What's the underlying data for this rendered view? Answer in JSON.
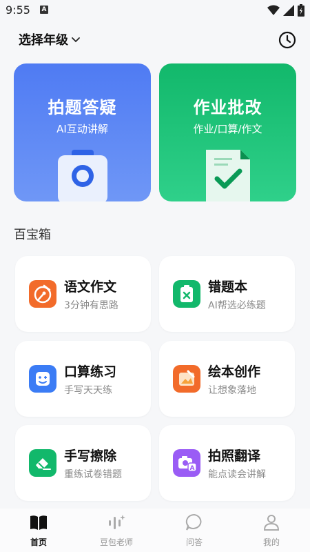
{
  "status_bar": {
    "time": "9:55",
    "notification_letter": "A"
  },
  "header": {
    "grade_selector": "选择年级"
  },
  "feature_cards": [
    {
      "title": "拍题答疑",
      "subtitle": "AI互动讲解",
      "color": "#4f7bf3"
    },
    {
      "title": "作业批改",
      "subtitle": "作业/口算/作文",
      "color": "#12b86b"
    }
  ],
  "toolbox": {
    "title": "百宝箱",
    "items": [
      {
        "name": "语文作文",
        "desc": "3分钟有思路",
        "color": "#f26b2a",
        "icon": "pen-icon"
      },
      {
        "name": "错题本",
        "desc": "AI帮选必练题",
        "color": "#12b86b",
        "icon": "clipboard-x-icon"
      },
      {
        "name": "口算练习",
        "desc": "手写天天练",
        "color": "#3b7cf5",
        "icon": "smile-face-icon"
      },
      {
        "name": "绘本创作",
        "desc": "让想象落地",
        "color": "#f26b2a",
        "icon": "picture-book-icon"
      },
      {
        "name": "手写擦除",
        "desc": "重练试卷错题",
        "color": "#12b86b",
        "icon": "eraser-icon"
      },
      {
        "name": "拍照翻译",
        "desc": "能点读会讲解",
        "color": "#9a5cf5",
        "icon": "camera-translate-icon"
      }
    ]
  },
  "tabs": [
    {
      "label": "首页",
      "icon": "book-icon",
      "active": true
    },
    {
      "label": "豆包老师",
      "icon": "voice-bars-icon",
      "active": false
    },
    {
      "label": "问答",
      "icon": "chat-bubble-icon",
      "active": false
    },
    {
      "label": "我的",
      "icon": "person-icon",
      "active": false
    }
  ]
}
